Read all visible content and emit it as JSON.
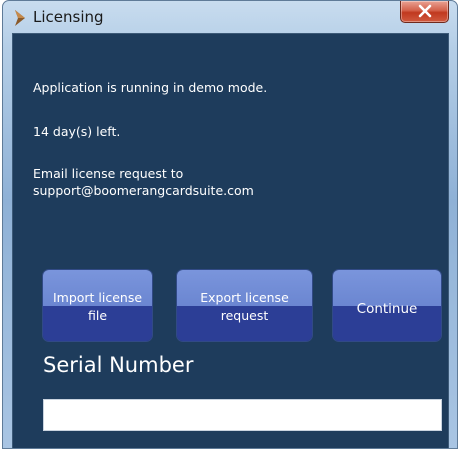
{
  "window": {
    "title": "Licensing",
    "close_label": "X"
  },
  "messages": {
    "demo_mode": "Application is running in demo mode.",
    "days_left": "14 day(s) left.",
    "email_line1": "Email license request to",
    "email_line2": "support@boomerangcardsuite.com"
  },
  "buttons": {
    "import_line1": "Import license",
    "import_line2": "file",
    "export_line1": "Export license",
    "export_line2": "request",
    "continue_label": "Continue"
  },
  "serial": {
    "label": "Serial Number",
    "value": ""
  },
  "colors": {
    "client_bg": "#1e3c5c",
    "button_top": "#7a95dc",
    "button_bottom": "#2c3e96",
    "close_red": "#c0391f"
  }
}
